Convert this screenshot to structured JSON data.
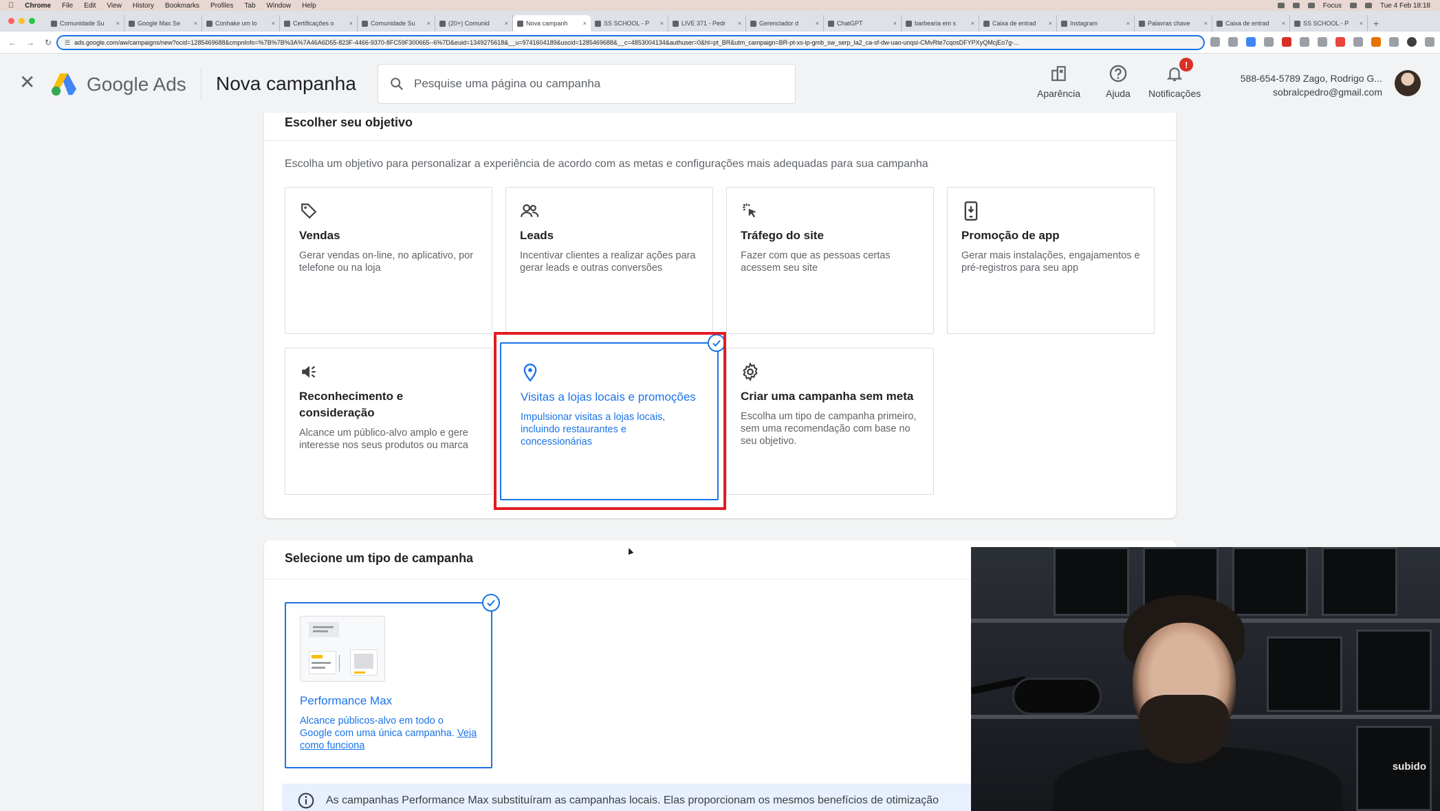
{
  "macbar": {
    "app": "Chrome",
    "menus": [
      "File",
      "Edit",
      "View",
      "History",
      "Bookmarks",
      "Profiles",
      "Tab",
      "Window",
      "Help"
    ],
    "focus": "Focus",
    "datetime": "Tue 4 Feb 18:18"
  },
  "browser": {
    "tabs": [
      {
        "title": "Comunidade Su"
      },
      {
        "title": "Google Max Se"
      },
      {
        "title": "Conhake um lo"
      },
      {
        "title": "Certificações o"
      },
      {
        "title": "Comunidade Su"
      },
      {
        "title": "(20+) Comunid"
      },
      {
        "title": "Nova campanh",
        "active": true
      },
      {
        "title": "SS SCHOOL - P"
      },
      {
        "title": "LIVE 371 - Pedr"
      },
      {
        "title": "Gerenciador d"
      },
      {
        "title": "ChatGPT"
      },
      {
        "title": "barbearia em s"
      },
      {
        "title": "Caixa de entrad"
      },
      {
        "title": "Instagram"
      },
      {
        "title": "Palavras chave"
      },
      {
        "title": "Caixa de entrad"
      },
      {
        "title": "SS SCHOOL - P"
      }
    ],
    "url": "ads.google.com/aw/campaigns/new?ocid=1285469688&cmpnInfo=%7B%7B%3A%7A46A6D55-823F-4466-9370-8FC59F300665--6%7D&euid=1349275618&__u=9741604189&uscid=1285469688&__c=4853004134&authuser=0&hl=pt_BR&utm_campaign=BR-pt-xs-ip-gmb_sw_serp_la2_ca-sf-dw-uao-unqsi-CMvRte7cqosDFYPXyQMcjEo7g-..."
  },
  "header": {
    "product_name": "Google Ads",
    "page_title": "Nova campanha",
    "search_placeholder": "Pesquise uma página ou campanha",
    "appearance_label": "Aparência",
    "help_label": "Ajuda",
    "notifications_label": "Notificações",
    "notifications_badge": "!",
    "account_line1": "588-654-5789 Zago, Rodrigo G...",
    "account_line2": "sobralcpedro@gmail.com"
  },
  "objective_section": {
    "title": "Escolher seu objetivo",
    "description": "Escolha um objetivo para personalizar a experiência de acordo com as metas e configurações mais adequadas para sua campanha",
    "objectives": [
      {
        "icon": "tag-icon",
        "name": "Vendas",
        "description": "Gerar vendas on-line, no aplicativo, por telefone ou na loja"
      },
      {
        "icon": "people-icon",
        "name": "Leads",
        "description": "Incentivar clientes a realizar ações para gerar leads e outras conversões"
      },
      {
        "icon": "cursor-click-icon",
        "name": "Tráfego do site",
        "description": "Fazer com que as pessoas certas acessem seu site"
      },
      {
        "icon": "phone-icon",
        "name": "Promoção de app",
        "description": "Gerar mais instalações, engajamentos e pré-registros para seu app"
      },
      {
        "icon": "megaphone-icon",
        "name": "Reconhecimento e consideração",
        "description": "Alcance um público-alvo amplo e gere interesse nos seus produtos ou marca"
      },
      {
        "icon": "location-pin-icon",
        "name": "Visitas a lojas locais e promoções",
        "description": "Impulsionar visitas a lojas locais, incluindo restaurantes e concessionárias",
        "selected": true
      },
      {
        "icon": "gear-icon",
        "name": "Criar uma campanha sem meta",
        "description": "Escolha um tipo de campanha primeiro, sem uma recomendação com base no seu objetivo."
      }
    ]
  },
  "campaign_type_section": {
    "title": "Selecione um tipo de campanha",
    "types": [
      {
        "name": "Performance Max",
        "description": "Alcance públicos-alvo em todo o Google com uma única campanha.",
        "link": "Veja como funciona",
        "selected": true
      }
    ],
    "info": "As campanhas Performance Max substituíram as campanhas locais. Elas proporcionam os mesmos benefícios de otimização"
  },
  "webcam": {
    "watermark": "subido"
  },
  "colors": {
    "accent": "#1a73e8",
    "highlight": "#e11b22",
    "badge": "#d93025"
  }
}
